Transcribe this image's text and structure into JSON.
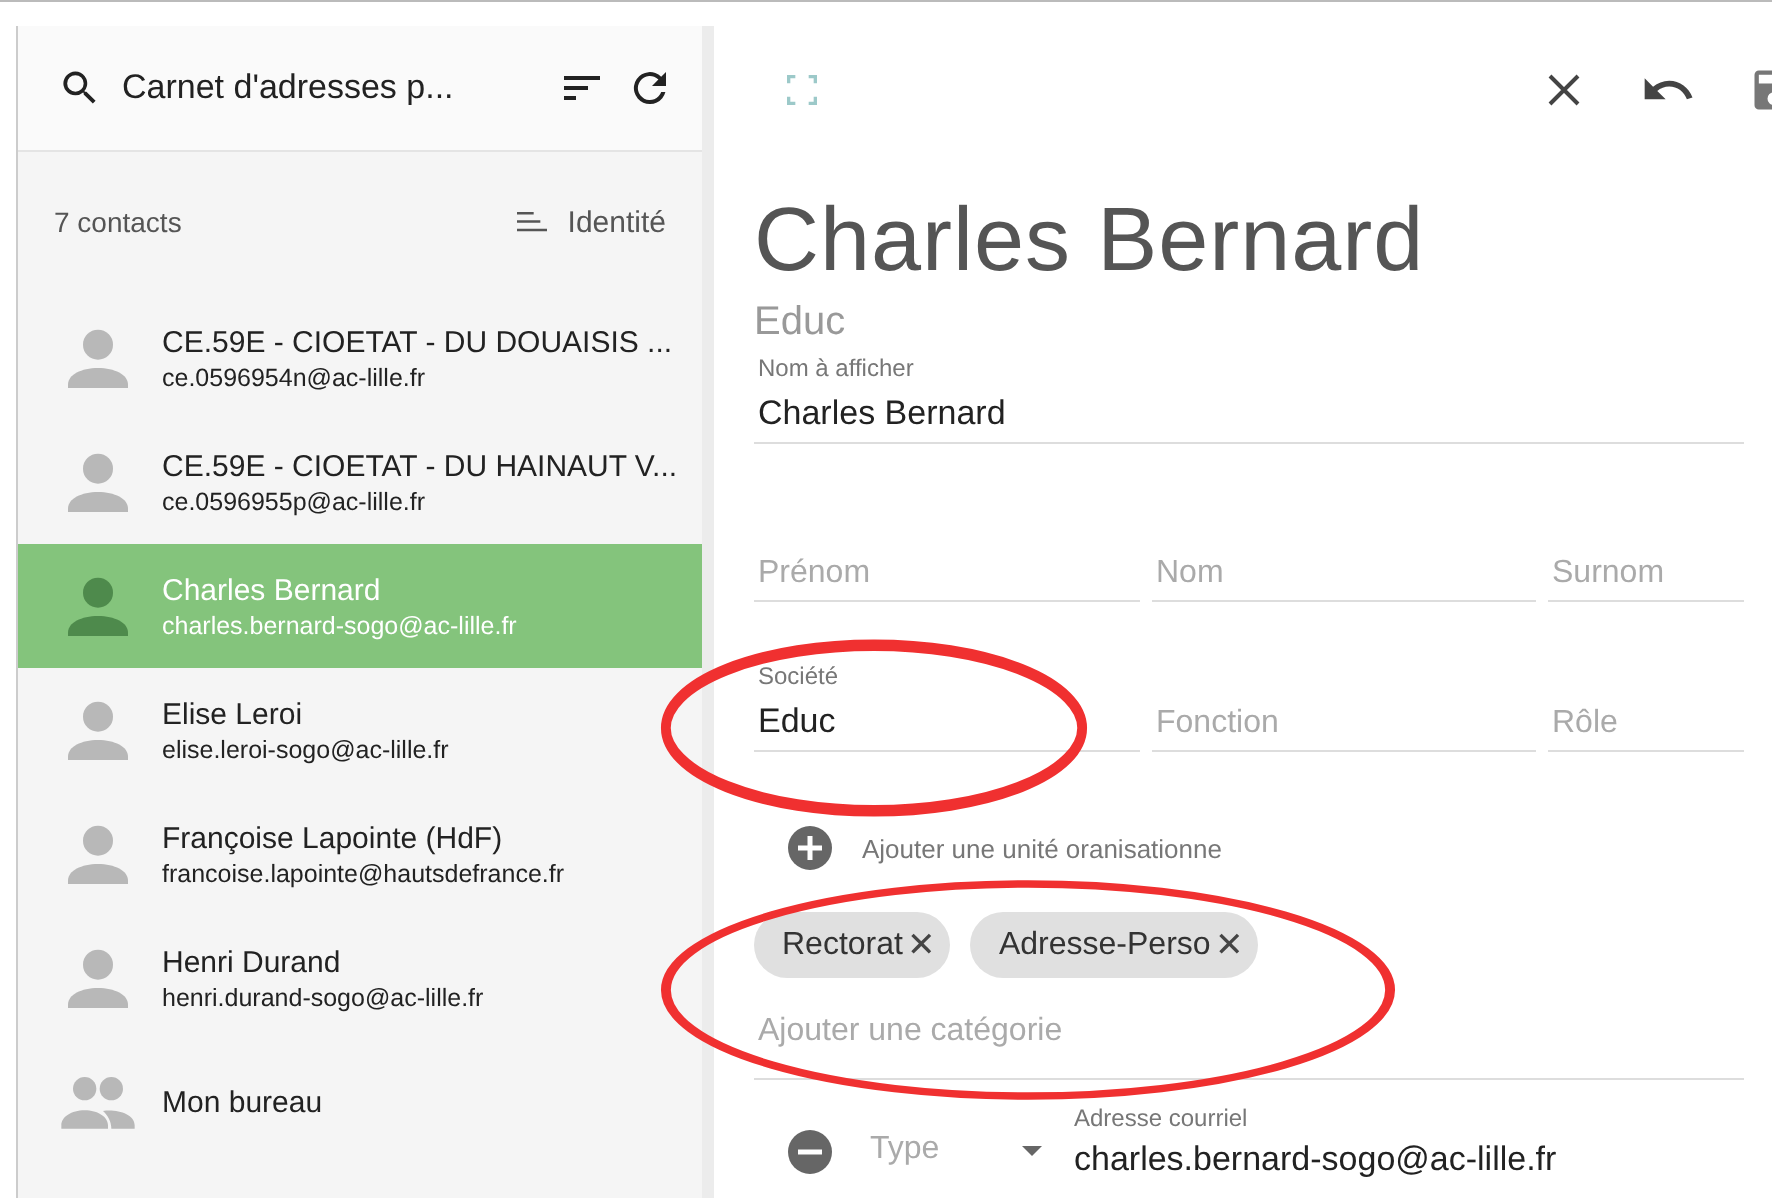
{
  "sidebar": {
    "title": "Carnet d'adresses p...",
    "count": "7 contacts",
    "sort_label": "Identité",
    "contacts": [
      {
        "kind": "person",
        "name": "CE.59E - CIOETAT - DU DOUAISIS ...",
        "email": "ce.0596954n@ac-lille.fr",
        "selected": false
      },
      {
        "kind": "person",
        "name": "CE.59E - CIOETAT - DU HAINAUT V...",
        "email": "ce.0596955p@ac-lille.fr",
        "selected": false
      },
      {
        "kind": "person",
        "name": "Charles Bernard",
        "email": "charles.bernard-sogo@ac-lille.fr",
        "selected": true
      },
      {
        "kind": "person",
        "name": "Elise Leroi",
        "email": "elise.leroi-sogo@ac-lille.fr",
        "selected": false
      },
      {
        "kind": "person",
        "name": "Françoise Lapointe (HdF)",
        "email": "francoise.lapointe@hautsdefrance.fr",
        "selected": false
      },
      {
        "kind": "person",
        "name": "Henri Durand",
        "email": "henri.durand-sogo@ac-lille.fr",
        "selected": false
      },
      {
        "kind": "group",
        "name": "Mon bureau",
        "selected": false
      }
    ]
  },
  "editor": {
    "title": "Charles Bernard",
    "subtitle": "Educ",
    "display_name": {
      "label": "Nom à afficher",
      "value": "Charles Bernard"
    },
    "name_fields": [
      {
        "placeholder": "Prénom"
      },
      {
        "placeholder": "Nom"
      },
      {
        "placeholder": "Surnom"
      }
    ],
    "org_fields": [
      {
        "label": "Société",
        "value": "Educ"
      },
      {
        "placeholder": "Fonction"
      },
      {
        "placeholder": "Rôle"
      }
    ],
    "add_unit": "Ajouter une unité oranisationne",
    "categories": [
      {
        "label": "Rectorat",
        "remove": "✕"
      },
      {
        "label": "Adresse-Perso",
        "remove": "✕"
      }
    ],
    "category_placeholder": "Ajouter une catégorie",
    "email": {
      "label": "Adresse courriel",
      "type_placeholder": "Type",
      "value": "charles.bernard-sogo@ac-lille.fr"
    }
  }
}
